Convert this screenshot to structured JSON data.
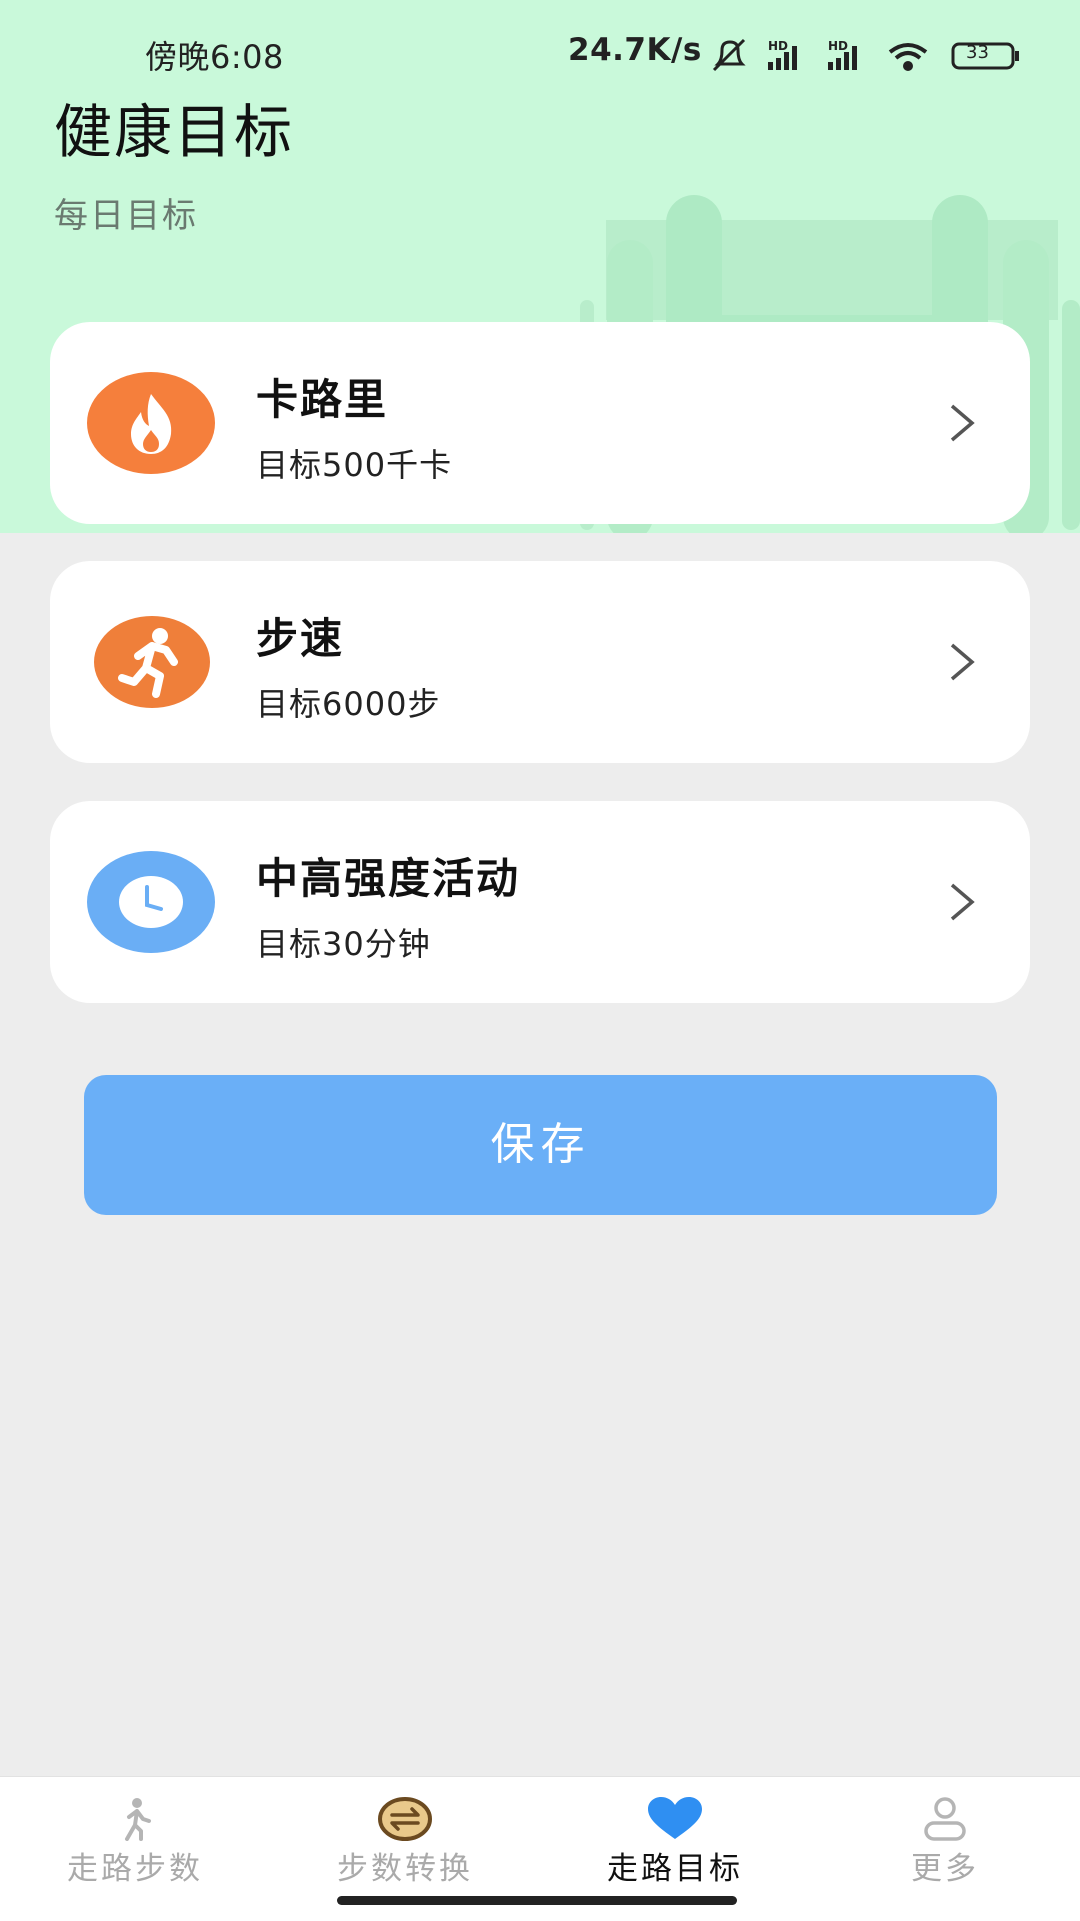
{
  "status_bar": {
    "time": "傍晚6:08",
    "network_speed": "24.7K/s",
    "battery": "33"
  },
  "header": {
    "title": "健康目标",
    "subtitle": "每日目标"
  },
  "goals": [
    {
      "title": "卡路里",
      "target": "目标500千卡",
      "icon": "flame-icon",
      "color": "#f57f3c"
    },
    {
      "title": "步速",
      "target": "目标6000步",
      "icon": "running-person-icon",
      "color": "#ef7f3a"
    },
    {
      "title": "中高强度活动",
      "target": "目标30分钟",
      "icon": "clock-icon",
      "color": "#6aaef5"
    }
  ],
  "save_button": {
    "label": "保存",
    "color": "#6aaff7"
  },
  "bottom_nav": [
    {
      "label": "走路步数",
      "icon": "walking-person-icon",
      "active": false
    },
    {
      "label": "步数转换",
      "icon": "swap-arrows-icon",
      "active": false
    },
    {
      "label": "走路目标",
      "icon": "heart-icon",
      "active": true
    },
    {
      "label": "更多",
      "icon": "user-icon",
      "active": false
    }
  ],
  "colors": {
    "hero_bg": "#c9f9da",
    "page_bg": "#ededed",
    "active_nav_icon": "#2f8ff2"
  }
}
